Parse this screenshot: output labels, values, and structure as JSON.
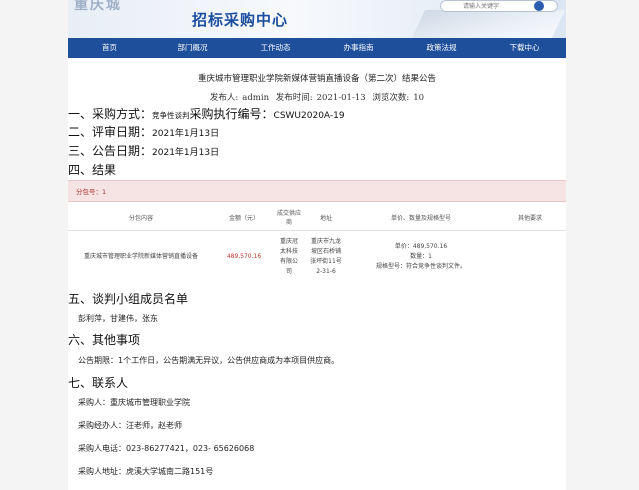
{
  "banner": {
    "watermark": "重庆城",
    "title": "招标采购中心",
    "search_placeholder": "请输入关键字"
  },
  "nav": [
    "首页",
    "部门概况",
    "工作动态",
    "办事指南",
    "政策法规",
    "下载中心"
  ],
  "article": {
    "title": "重庆城市管理职业学院新媒体营销直播设备（第二次）结果公告",
    "publisher_label": "发布人:",
    "publisher": "admin",
    "time_label": "发布时间:",
    "time": "2021-01-13",
    "views_label": "浏览次数:",
    "views": "10"
  },
  "sections": {
    "s1_head": "一、采购方式：",
    "s1_method": "竞争性谈判",
    "s1_code_label": "采购执行编号：",
    "s1_code": "CSWU2020A-19",
    "s2_head": "二、评审日期：",
    "s2_val": "2021年1月13日",
    "s3_head": "三、公告日期：",
    "s3_val": "2021年1月13日",
    "s4_head": "四、结果",
    "s5_head": "五、谈判小组成员名单",
    "s5_members": "彭利萍，甘建伟，张东",
    "s6_head": "六、其他事项",
    "s6_text": "公告期限：1个工作日，公告期满无异议，公告供应商成为本项目供应商。",
    "s7_head": "七、联系人"
  },
  "result": {
    "package_label": "分包号：1",
    "headers": [
      "分包内容",
      "金额（元）",
      "成交供应商",
      "地址",
      "单价、数量及规格型号",
      "其他要求"
    ],
    "row": {
      "content": "重庆城市管理职业学院新媒体营销直播设备",
      "amount": "489,570.16",
      "supplier": [
        "重庆冠",
        "太科技",
        "有限公",
        "司"
      ],
      "address": [
        "重庆市九龙",
        "坡区石桥铺",
        "张坪街11号",
        "2-31-6"
      ],
      "spec": [
        "单价：489,570.16",
        "数量：1",
        "规格型号：符合竞争性谈判文件。"
      ],
      "other": ""
    }
  },
  "contact": {
    "buyer": "采购人：重庆城市管理职业学院",
    "handler": "采购经办人：汪老师，赵老师",
    "phone": "采购人电话：023-86277421，023- 65626068",
    "address": "采购人地址：虎溪大学城南二路151号"
  }
}
